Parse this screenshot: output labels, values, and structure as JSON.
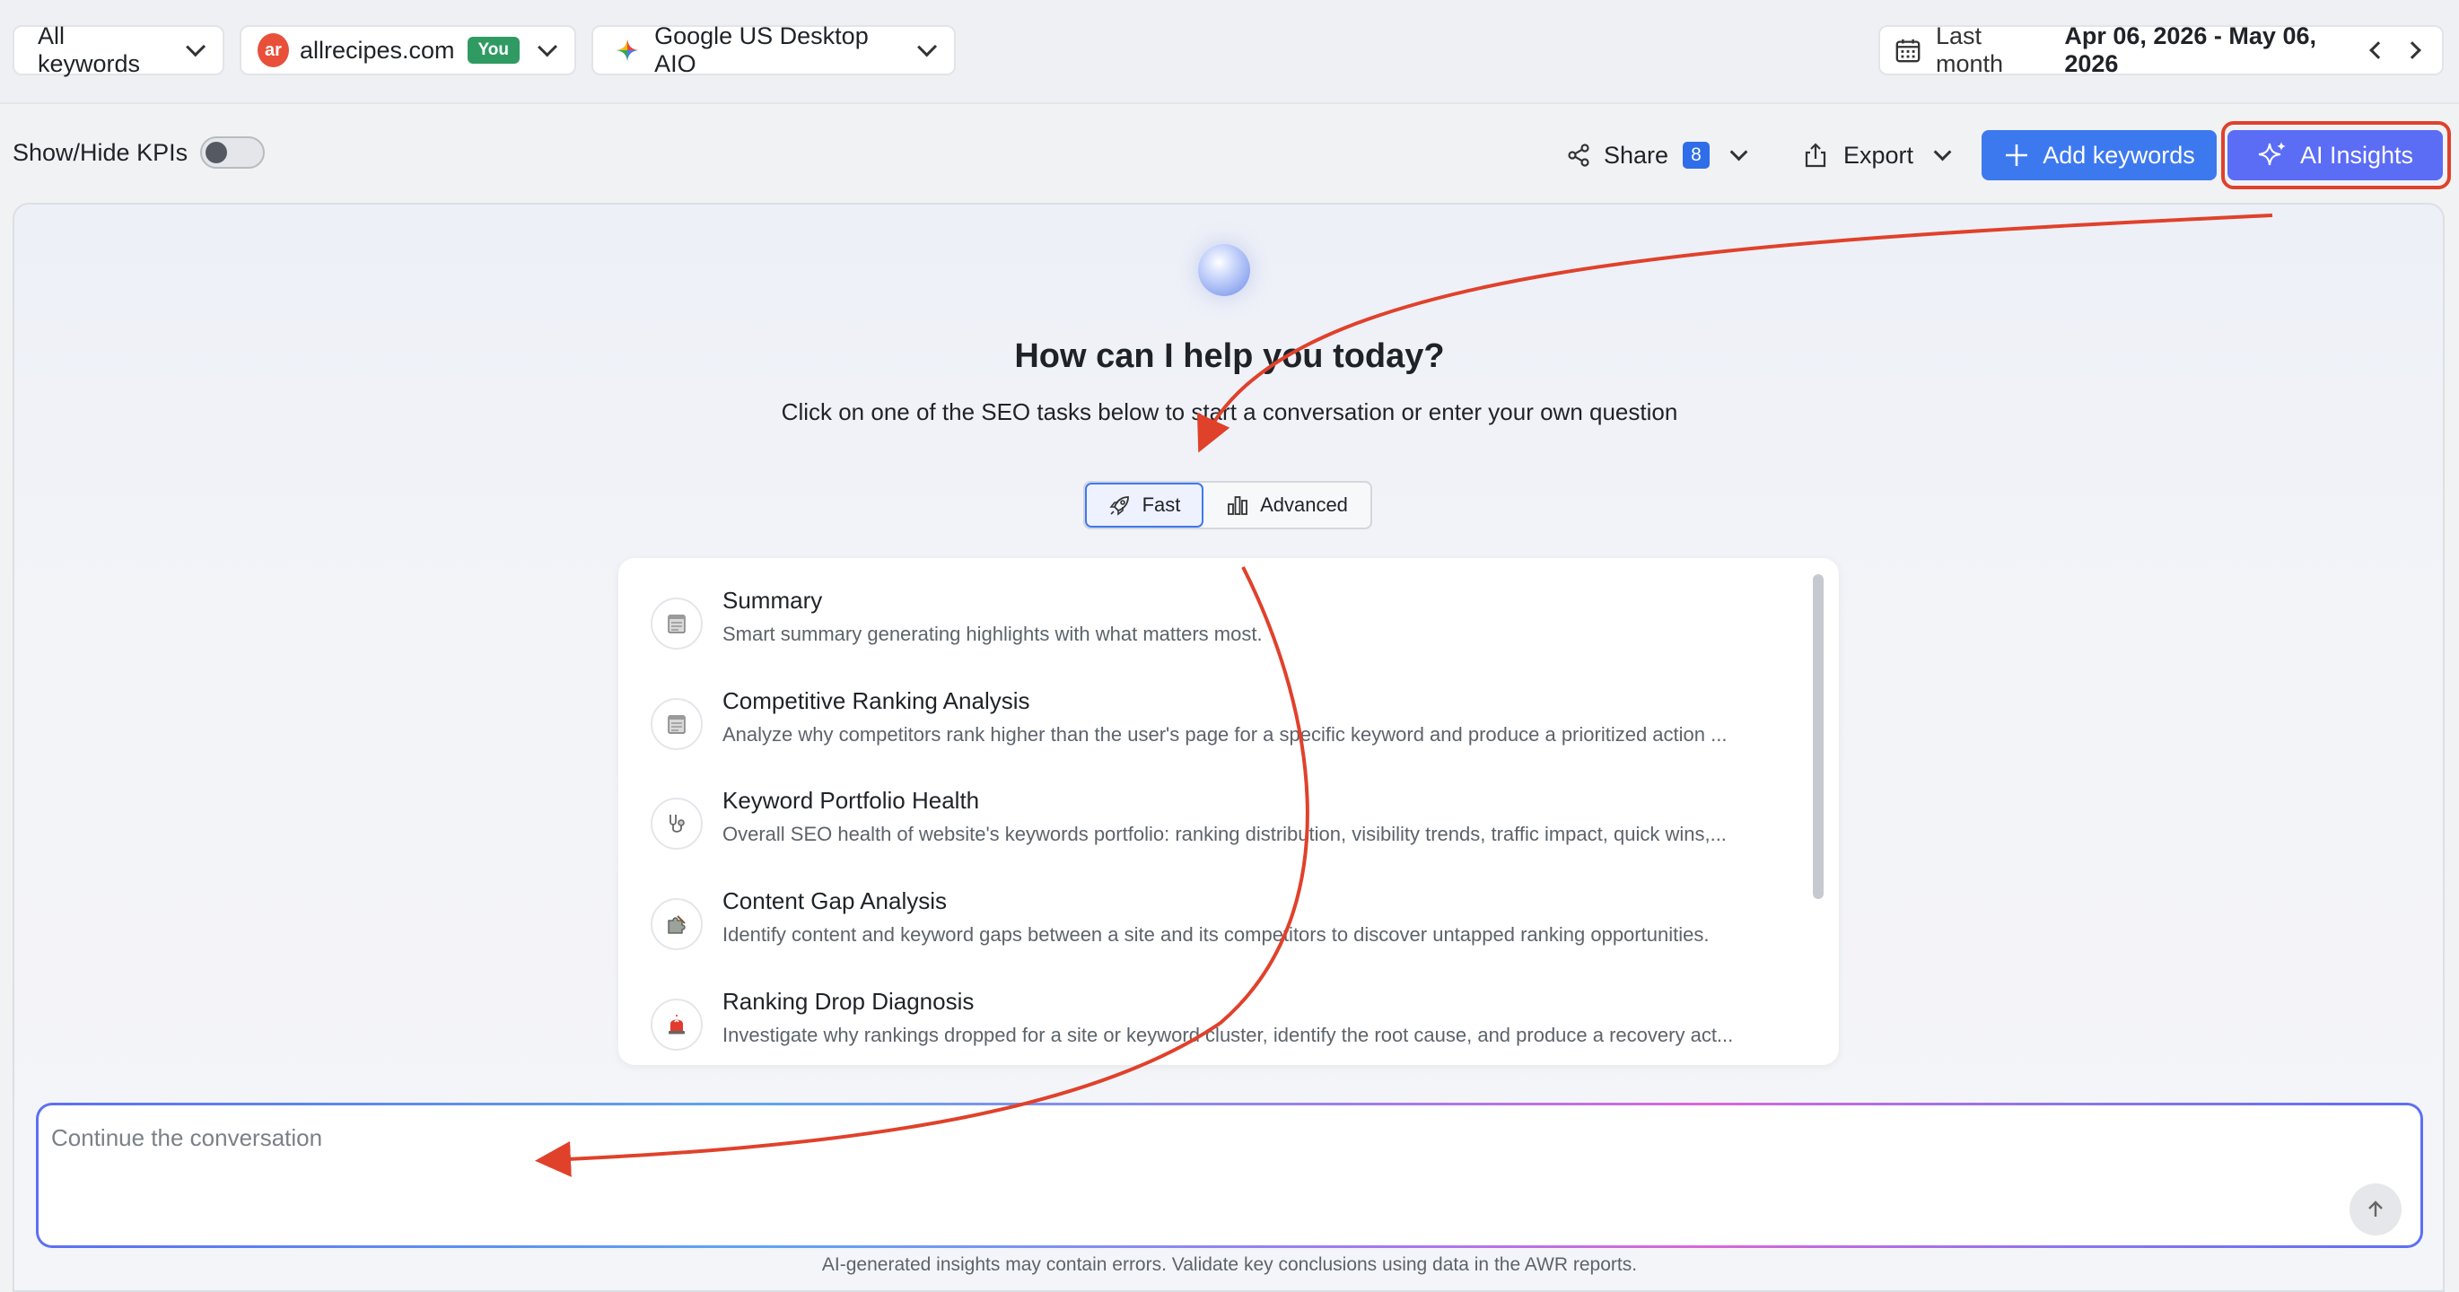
{
  "topbar": {
    "keywords_filter": "All keywords",
    "site": {
      "logo_text": "ar",
      "name": "allrecipes.com",
      "badge": "You"
    },
    "engine": "Google US Desktop AIO",
    "date": {
      "period": "Last month",
      "range": "Apr 06, 2026 - May 06, 2026"
    }
  },
  "toolbar": {
    "kpi_toggle_label": "Show/Hide KPIs",
    "kpi_toggle_on": false,
    "share_label": "Share",
    "share_count": "8",
    "export_label": "Export",
    "add_keywords_label": "Add keywords",
    "ai_insights_label": "AI Insights"
  },
  "assistant": {
    "headline": "How can I help you today?",
    "subline": "Click on one of the SEO tasks below to start a conversation or enter your own question",
    "modes": {
      "fast": "Fast",
      "advanced": "Advanced",
      "selected": "Fast"
    },
    "tasks": [
      {
        "title": "Summary",
        "description": "Smart summary generating highlights with what matters most.",
        "icon": "notepad-icon"
      },
      {
        "title": "Competitive Ranking Analysis",
        "description": "Analyze why competitors rank higher than the user's page for a specific keyword and produce a prioritized action ...",
        "icon": "notepad-icon"
      },
      {
        "title": "Keyword Portfolio Health",
        "description": "Overall SEO health of website's keywords portfolio: ranking distribution, visibility trends, traffic impact, quick wins,...",
        "icon": "stethoscope-icon"
      },
      {
        "title": "Content Gap Analysis",
        "description": "Identify content and keyword gaps between a site and its competitors to discover untapped ranking opportunities.",
        "icon": "puzzle-icon"
      },
      {
        "title": "Ranking Drop Diagnosis",
        "description": "Investigate why rankings dropped for a site or keyword cluster, identify the root cause, and produce a recovery act...",
        "icon": "siren-icon"
      }
    ],
    "chat_placeholder": "Continue the conversation",
    "disclaimer": "AI-generated insights may contain errors. Validate key conclusions using data in the AWR reports."
  },
  "colors": {
    "primary": "#3d79ee",
    "ai_button": "#5b6cf5",
    "annotation": "#e0412b",
    "you_badge": "#2f9b62"
  }
}
